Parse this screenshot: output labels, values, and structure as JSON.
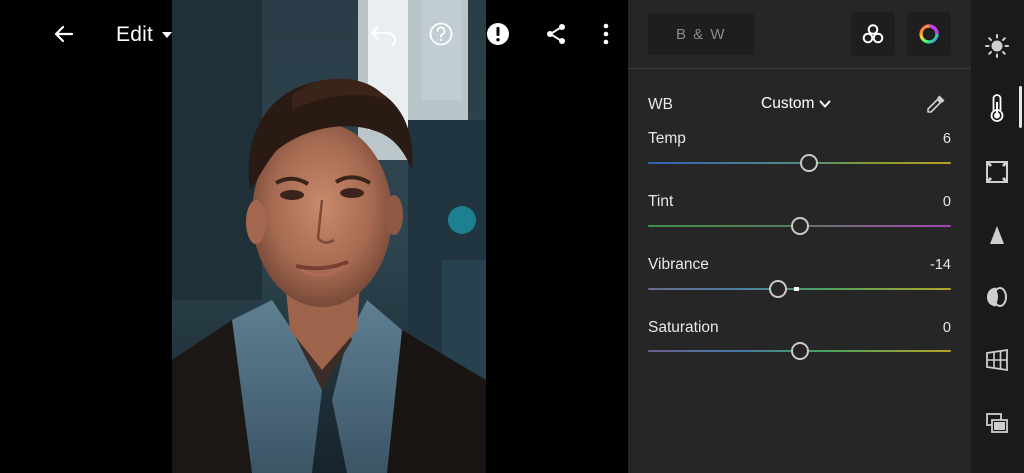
{
  "app": {
    "edit_label": "Edit"
  },
  "toolbar": {
    "icons": [
      "back-arrow-icon",
      "undo-icon",
      "help-icon",
      "alert-icon",
      "share-icon",
      "more-vert-icon"
    ]
  },
  "panel": {
    "bw_label": "B & W",
    "wb": {
      "label": "WB",
      "value": "Custom"
    },
    "sliders": [
      {
        "label": "Temp",
        "value": "6",
        "position": 0.53
      },
      {
        "label": "Tint",
        "value": "0",
        "position": 0.5
      },
      {
        "label": "Vibrance",
        "value": "-14",
        "position": 0.43
      },
      {
        "label": "Saturation",
        "value": "0",
        "position": 0.5
      }
    ]
  },
  "rail": {
    "tools": [
      "light-icon",
      "color-icon",
      "effects-icon",
      "detail-icon",
      "optics-icon",
      "geometry-icon",
      "versions-icon"
    ],
    "active": "color-icon"
  },
  "colors": {
    "panel_bg": "#262626",
    "rail_bg": "#1a1a1a"
  }
}
